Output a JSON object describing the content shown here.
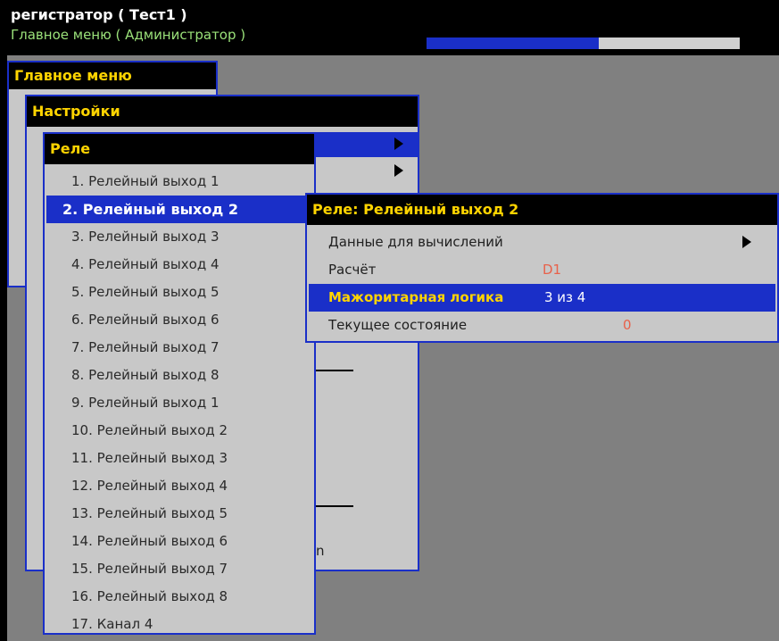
{
  "header": {
    "title": "регистратор ( Тест1 )",
    "subtitle": "Главное меню ( Администратор )",
    "progress": 0.55
  },
  "main_menu": {
    "title": "Главное меню"
  },
  "settings_menu": {
    "title": "Настройки",
    "partial_text": "n"
  },
  "relay_menu": {
    "title": "Реле",
    "items": [
      "1. Релейный выход 1",
      "2. Релейный выход 2",
      "3. Релейный выход 3",
      "4. Релейный выход 4",
      "5. Релейный выход 5",
      "6. Релейный выход 6",
      "7. Релейный выход 7",
      "8. Релейный выход 8",
      "9. Релейный выход 1",
      "10. Релейный выход 2",
      "11. Релейный выход 3",
      "12. Релейный выход 4",
      "13. Релейный выход 5",
      "14. Релейный выход 6",
      "15. Релейный выход 7",
      "16. Релейный выход 8",
      "17. Канал 4"
    ],
    "selected_index": 1
  },
  "detail_menu": {
    "title": "Реле: Релейный выход 2",
    "rows": [
      {
        "label": "Данные для вычислений",
        "value": ""
      },
      {
        "label": "Расчёт",
        "value": "D1"
      },
      {
        "label": "Мажоритарная логика",
        "value": "3 из 4"
      },
      {
        "label": "Текущее состояние",
        "value": "0"
      }
    ]
  },
  "colors": {
    "accent": "#1a2fc8",
    "header_text": "#ffd400",
    "value_text": "#e8614a",
    "panel_bg": "#c8c8c8",
    "desktop_bg": "#808080"
  }
}
